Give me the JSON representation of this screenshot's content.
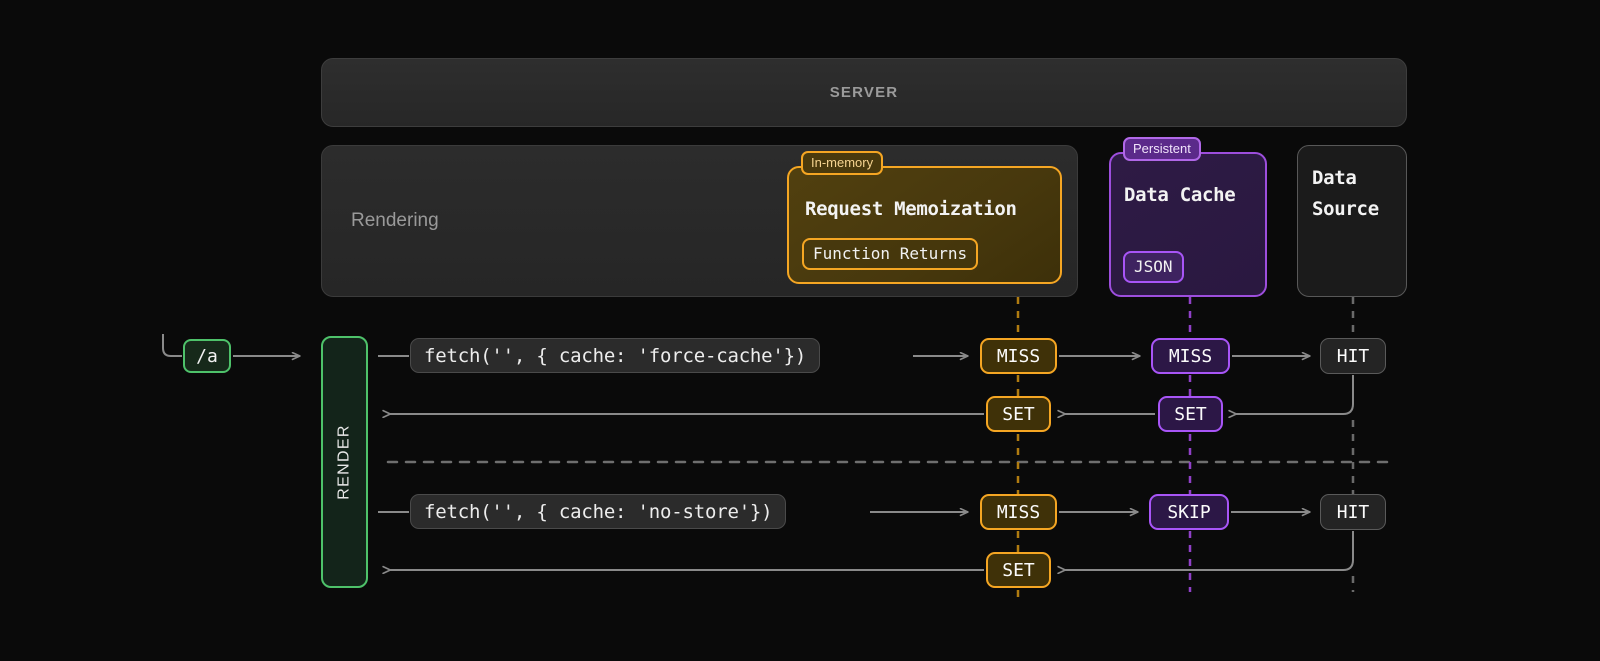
{
  "theme": {
    "background": "#0a0a0a",
    "amber": "#f5a623",
    "purple": "#a855f7",
    "green": "#4ec26a",
    "gray_line": "#8a8a8a",
    "panel": "#2a2a2a"
  },
  "server": {
    "label": "SERVER"
  },
  "rendering": {
    "label": "Rendering"
  },
  "memoization": {
    "badge": "In-memory",
    "title": "Request Memoization",
    "tag": "Function Returns"
  },
  "data_cache": {
    "badge": "Persistent",
    "title": "Data Cache",
    "tag": "JSON"
  },
  "data_source": {
    "title": "Data\nSource",
    "line1": "Data",
    "line2": "Source"
  },
  "route": {
    "label": "/a"
  },
  "render_column": {
    "label": "RENDER"
  },
  "rows": [
    {
      "code": "fetch('', { cache: 'force-cache'})",
      "memo_status": "MISS",
      "cache_status": "MISS",
      "source_status": "HIT",
      "memo_return": "SET",
      "cache_return": "SET"
    },
    {
      "code": "fetch('', { cache: 'no-store'})",
      "memo_status": "MISS",
      "cache_status": "SKIP",
      "source_status": "HIT",
      "memo_return": "SET",
      "cache_return": null
    }
  ]
}
